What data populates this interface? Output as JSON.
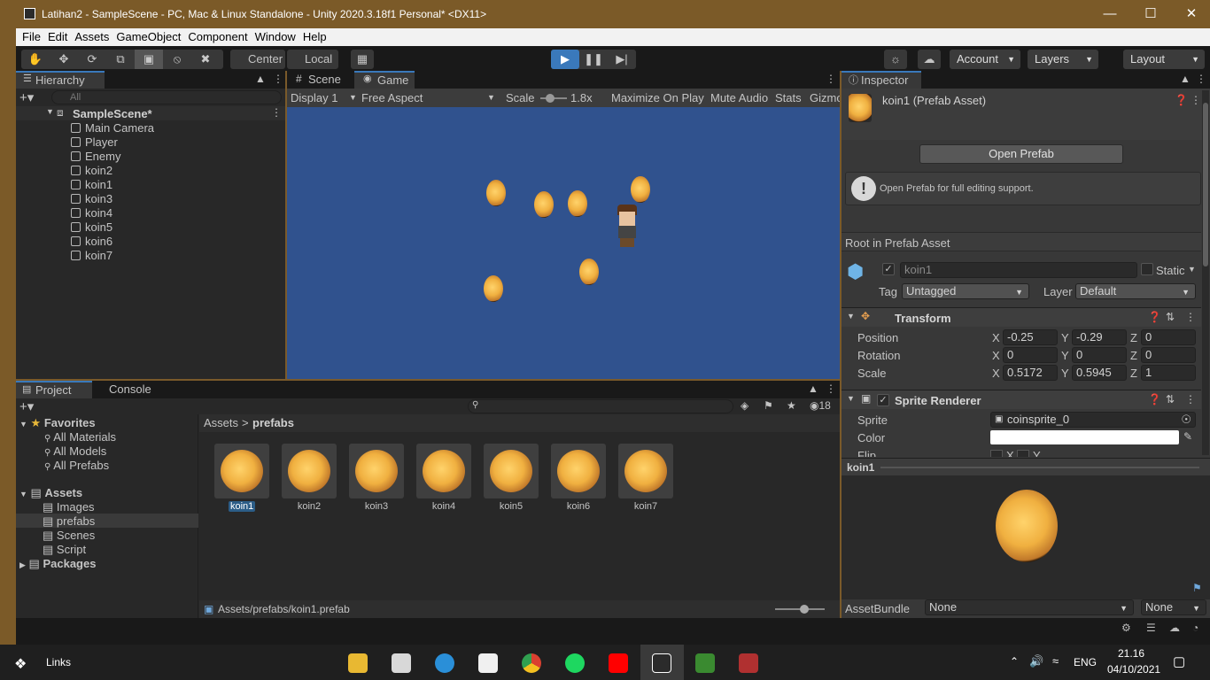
{
  "window": {
    "title": "Latihan2 - SampleScene - PC, Mac & Linux Standalone - Unity 2020.3.18f1 Personal* <DX11>"
  },
  "menu": [
    "File",
    "Edit",
    "Assets",
    "GameObject",
    "Component",
    "Window",
    "Help"
  ],
  "toolbar": {
    "pivot": "Center",
    "space": "Local",
    "account": "Account",
    "layers": "Layers",
    "layout": "Layout"
  },
  "hierarchy": {
    "tab": "Hierarchy",
    "search_placeholder": "All",
    "scene": "SampleScene*",
    "items": [
      "Main Camera",
      "Player",
      "Enemy",
      "koin2",
      "koin1",
      "koin3",
      "koin4",
      "koin5",
      "koin6",
      "koin7"
    ]
  },
  "game": {
    "tabs": [
      "Scene",
      "Game"
    ],
    "display": "Display 1",
    "aspect": "Free Aspect",
    "scale_label": "Scale",
    "scale_value": "1.8x",
    "options": [
      "Maximize On Play",
      "Mute Audio",
      "Stats",
      "Gizmo"
    ]
  },
  "project": {
    "tabs": [
      "Project",
      "Console"
    ],
    "hidden_count": "18",
    "favorites_label": "Favorites",
    "favorites": [
      "All Materials",
      "All Models",
      "All Prefabs"
    ],
    "assets_label": "Assets",
    "folders": [
      "Images",
      "prefabs",
      "Scenes",
      "Script"
    ],
    "packages_label": "Packages",
    "breadcrumb": [
      "Assets",
      "prefabs"
    ],
    "breadcrumb_sep": ">",
    "files": [
      "koin1",
      "koin2",
      "koin3",
      "koin4",
      "koin5",
      "koin6",
      "koin7"
    ],
    "status_path": "Assets/prefabs/koin1.prefab"
  },
  "inspector": {
    "tab": "Inspector",
    "asset_title": "koin1 (Prefab Asset)",
    "open_prefab": "Open Prefab",
    "info": "Open Prefab for full editing support.",
    "root_label": "Root in Prefab Asset",
    "object_name": "koin1",
    "static_label": "Static",
    "tag_label": "Tag",
    "tag_value": "Untagged",
    "layer_label": "Layer",
    "layer_value": "Default",
    "transform": {
      "title": "Transform",
      "position_label": "Position",
      "rotation_label": "Rotation",
      "scale_label": "Scale",
      "axes": [
        "X",
        "Y",
        "Z"
      ],
      "position": [
        "-0.25",
        "-0.29",
        "0"
      ],
      "rotation": [
        "0",
        "0",
        "0"
      ],
      "scale": [
        "0.5172",
        "0.5945",
        "1"
      ]
    },
    "sprite_renderer": {
      "title": "Sprite Renderer",
      "sprite_label": "Sprite",
      "sprite_value": "coinsprite_0",
      "color_label": "Color",
      "flip_label": "Flip",
      "flip_axes": [
        "X",
        "Y"
      ]
    },
    "preview_title": "koin1",
    "assetbundle_label": "AssetBundle",
    "assetbundle_value": "None",
    "assetbundle_variant": "None"
  },
  "taskbar": {
    "links": "Links",
    "lang": "ENG",
    "time": "21.16",
    "date": "04/10/2021"
  }
}
